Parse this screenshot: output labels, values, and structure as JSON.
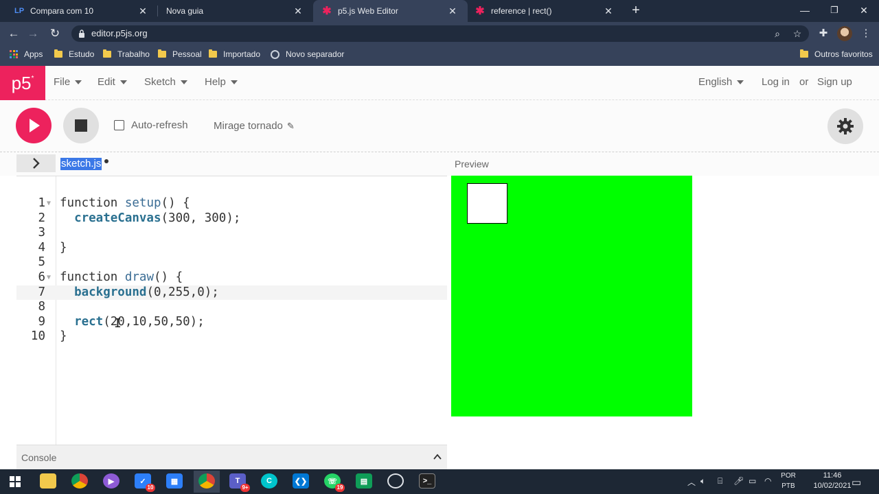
{
  "browser": {
    "tabs": [
      {
        "title": "Compara com 10",
        "icon": "lp-icon"
      },
      {
        "title": "Nova guia",
        "icon": "none"
      },
      {
        "title": "p5.js Web Editor",
        "icon": "p5-asterisk-icon"
      },
      {
        "title": "reference | rect()",
        "icon": "p5-asterisk-icon"
      }
    ],
    "active_tab_index": 2,
    "url": "editor.p5js.org",
    "bookmarks": [
      "Apps",
      "Estudo",
      "Trabalho",
      "Pessoal",
      "Importado",
      "Novo separador"
    ],
    "other_bookmarks": "Outros favoritos"
  },
  "p5": {
    "logo": "p5",
    "logo_sup": "*",
    "menus": [
      "File",
      "Edit",
      "Sketch",
      "Help"
    ],
    "language": "English",
    "login": "Log in",
    "or": "or",
    "signup": "Sign up",
    "auto_refresh_label": "Auto-refresh",
    "auto_refresh_checked": false,
    "sketch_name": "Mirage tornado",
    "file_name": "sketch.js",
    "preview_label": "Preview",
    "console_label": "Console",
    "accent_color": "#ed225d",
    "canvas_background": "#00ff00"
  },
  "code_lines": [
    {
      "n": "1",
      "text": "function setup() {"
    },
    {
      "n": "2",
      "text": "  createCanvas(300, 300);"
    },
    {
      "n": "3",
      "text": ""
    },
    {
      "n": "4",
      "text": "}"
    },
    {
      "n": "5",
      "text": ""
    },
    {
      "n": "6",
      "text": "function draw() {"
    },
    {
      "n": "7",
      "text": "  background(0,255,0);"
    },
    {
      "n": "8",
      "text": ""
    },
    {
      "n": "9",
      "text": "  rect(20,10,50,50);"
    },
    {
      "n": "10",
      "text": "}"
    }
  ],
  "taskbar": {
    "lang_top": "POR",
    "lang_bottom": "PTB",
    "time": "11:46",
    "date": "10/02/2021",
    "badges": {
      "todo": "10",
      "teams": "9+",
      "whatsapp": "19"
    }
  }
}
